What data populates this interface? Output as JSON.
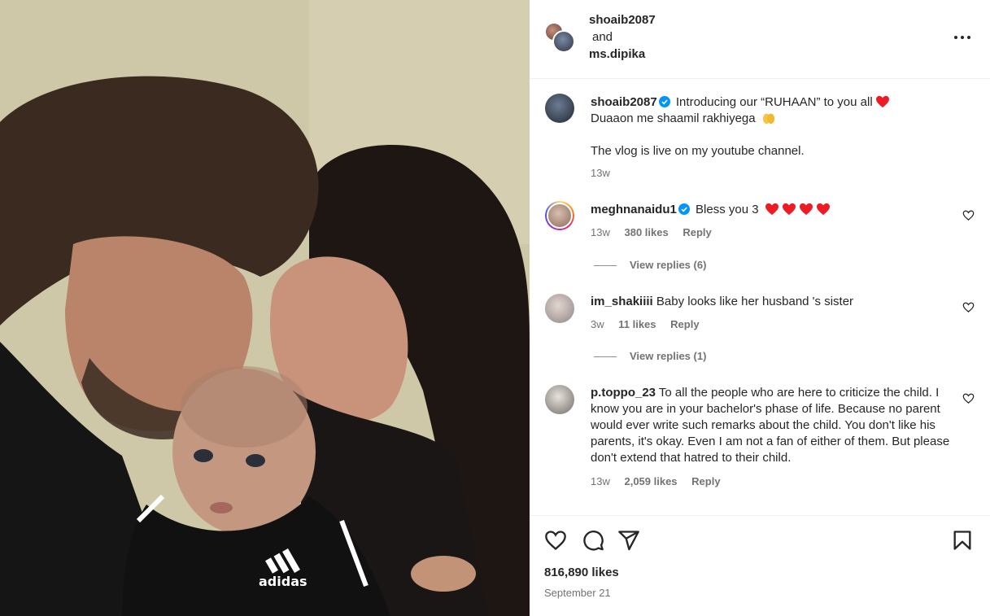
{
  "header": {
    "user1": "shoaib2087",
    "joiner": "and",
    "user2": "ms.dipika"
  },
  "caption": {
    "username": "shoaib2087",
    "line1": "Introducing our “RUHAAN” to you all",
    "line2": "Duaaon me shaamil rakhiyega",
    "line3": "The vlog is live on my youtube channel.",
    "time": "13w"
  },
  "comments": [
    {
      "username": "meghnanaidu1",
      "text": "Bless you 3",
      "time": "13w",
      "likes": "380 likes",
      "reply": "Reply",
      "view_replies": "View replies (6)"
    },
    {
      "username": "im_shakiiii",
      "text": "Baby looks like her husband 's sister",
      "time": "3w",
      "likes": "11 likes",
      "reply": "Reply",
      "view_replies": "View replies (1)"
    },
    {
      "username": "p.toppo_23",
      "text": "To all the people who are here to criticize the child. I know you are in your bachelor's phase of life. Because no parent would ever write such remarks about the child. You don't like his parents, it's okay. Even I am not a fan of either of them. But please don't extend that hatred to their child.",
      "time": "13w",
      "likes": "2,059 likes",
      "reply": "Reply"
    }
  ],
  "footer": {
    "likes": "816,890 likes",
    "date": "September 21"
  },
  "photo": {
    "jacket_logo": "adidas"
  },
  "icons": {
    "like": "heart-icon",
    "comment": "comment-icon",
    "share": "share-icon",
    "save": "bookmark-icon",
    "more": "more-options-icon",
    "verified": "verified-badge-icon"
  },
  "colors": {
    "verified": "#0095f6",
    "heart_red": "#ed1c24",
    "muted": "#737373"
  }
}
